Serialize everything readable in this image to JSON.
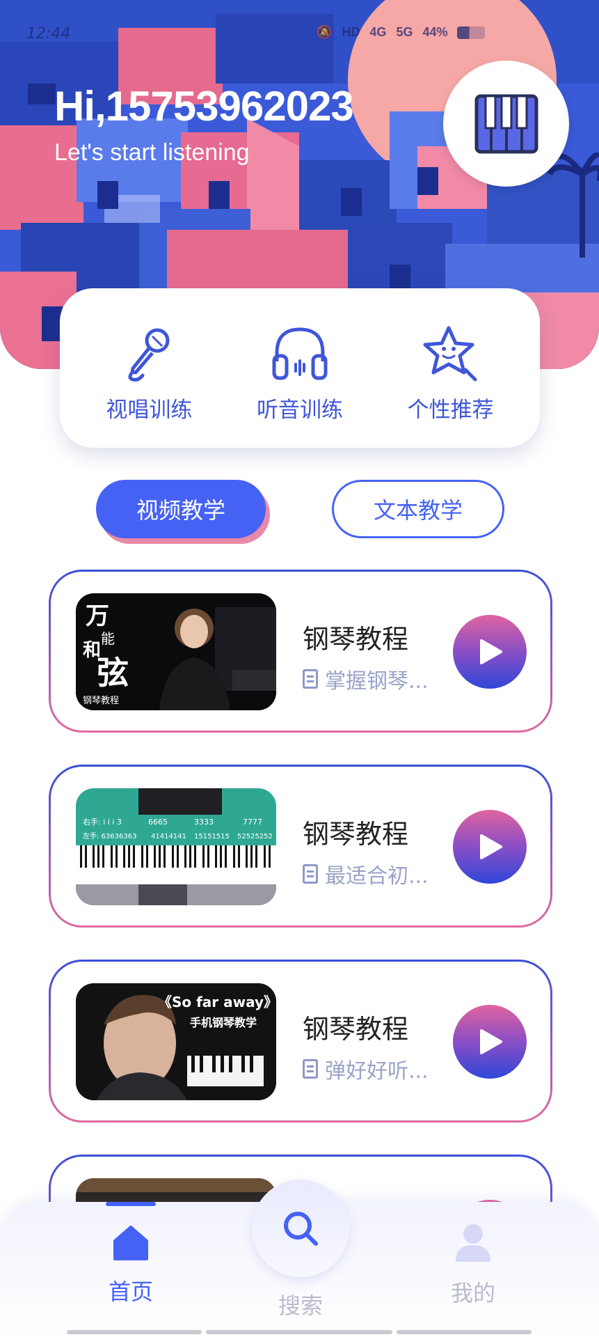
{
  "status_bar": {
    "time": "12:44",
    "icons_text": [
      "HD",
      "4G",
      "5G",
      "44%"
    ]
  },
  "header": {
    "greeting": "Hi,15753962023",
    "subtitle": "Let's start listening",
    "badge_icon": "piano-icon"
  },
  "features": [
    {
      "label": "视唱训练",
      "icon": "microphone-icon"
    },
    {
      "label": "听音训练",
      "icon": "headphones-icon"
    },
    {
      "label": "个性推荐",
      "icon": "star-icon"
    }
  ],
  "tabs": {
    "video": "视频教学",
    "text": "文本教学",
    "active": "video"
  },
  "courses": [
    {
      "title": "钢琴教程",
      "desc": "掌握钢琴...",
      "thumb_text": [
        "万",
        "能",
        "和",
        "弦",
        "钢琴教程"
      ]
    },
    {
      "title": "钢琴教程",
      "desc": "最适合初...",
      "thumb_text": [
        "右手: i i i 3",
        "6665",
        "3333",
        "7777",
        "左手: 63636363",
        "41414141",
        "15151515",
        "52525252"
      ]
    },
    {
      "title": "钢琴教程",
      "desc": "弹好好听...",
      "thumb_text": [
        "《So far away》",
        "手机钢琴教学"
      ]
    },
    {
      "title": "",
      "desc": "",
      "thumb_text": []
    }
  ],
  "bottom_nav": {
    "home": "首页",
    "search": "搜索",
    "mine": "我的",
    "active": "home"
  },
  "colors": {
    "accent": "#4662f5",
    "pink": "#e889a7",
    "feature_text": "#3f56d8",
    "desc_text": "#9aa3c9"
  }
}
